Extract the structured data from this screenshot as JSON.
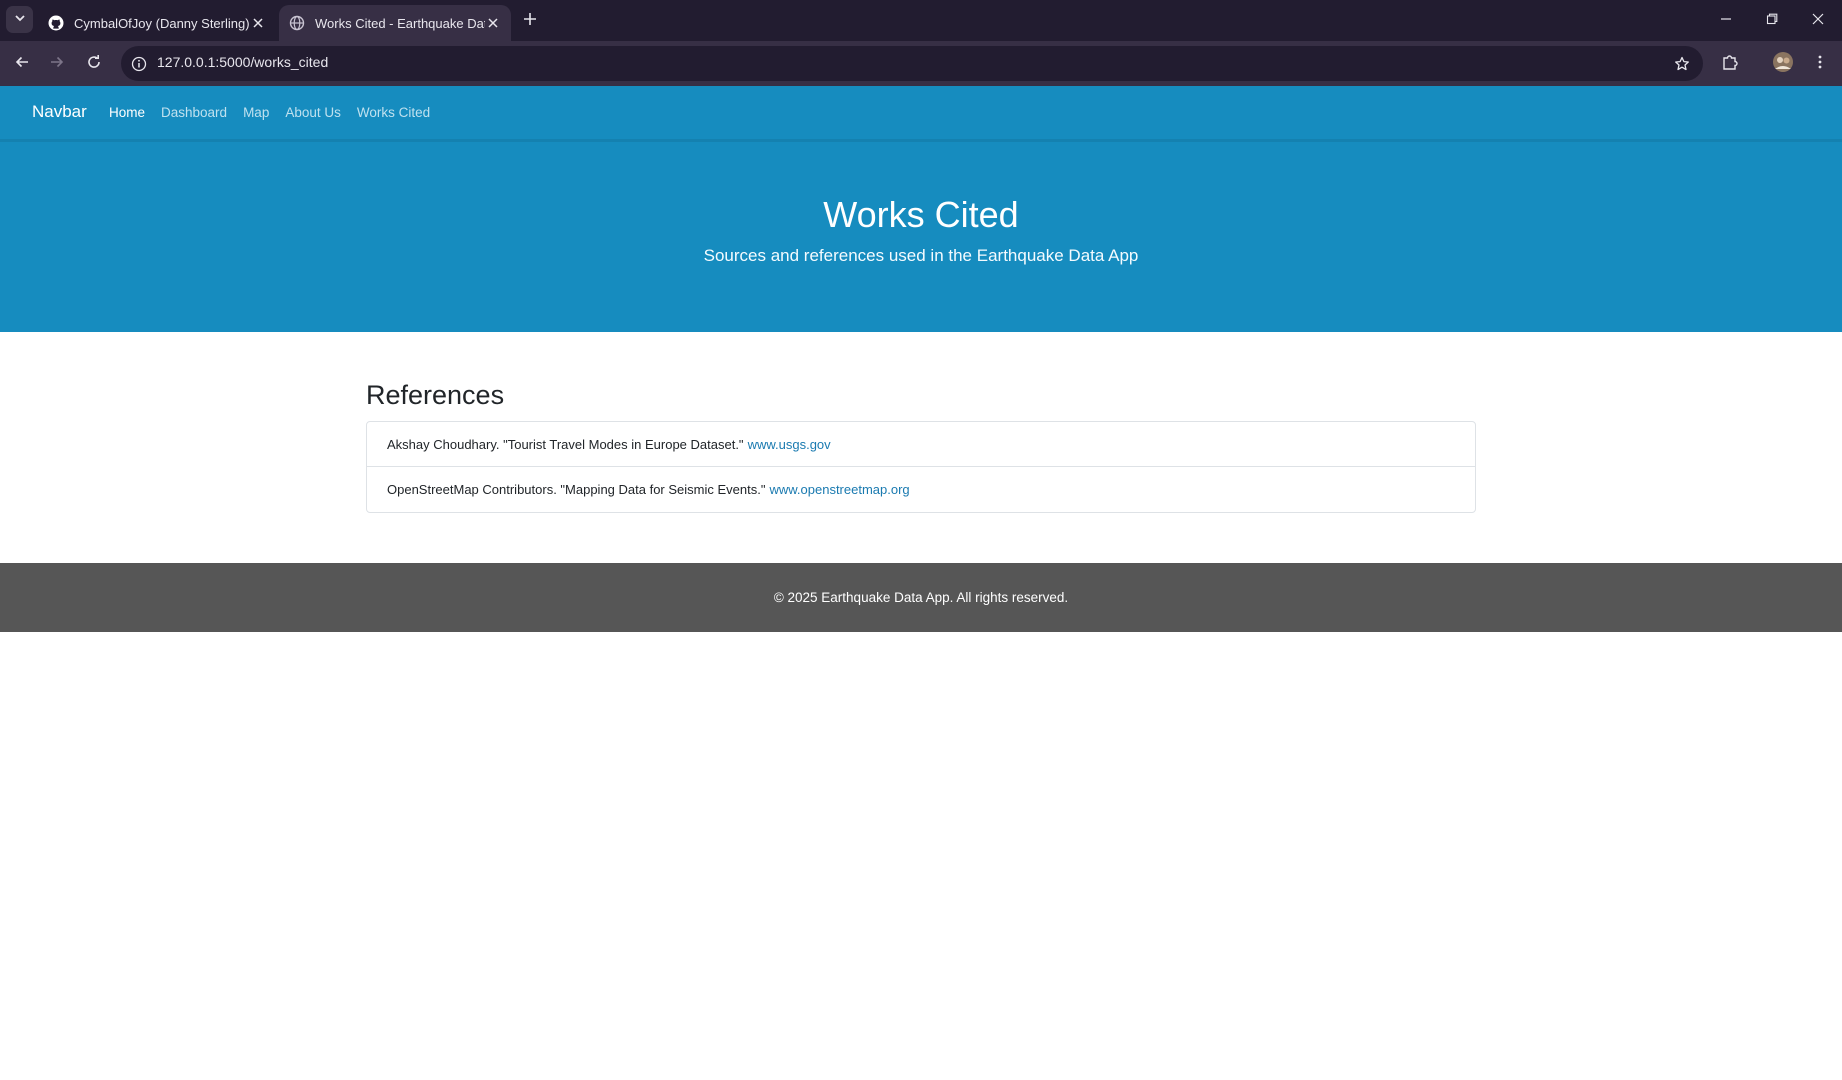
{
  "browser": {
    "tabs": [
      {
        "title": "CymbalOfJoy (Danny Sterling)",
        "icon": "github-icon"
      },
      {
        "title": "Works Cited - Earthquake Data",
        "icon": "globe-icon",
        "active": true
      }
    ],
    "url": "127.0.0.1:5000/works_cited"
  },
  "navbar": {
    "brand": "Navbar",
    "links": [
      "Home",
      "Dashboard",
      "Map",
      "About Us",
      "Works Cited"
    ],
    "active": "Home"
  },
  "hero": {
    "title": "Works Cited",
    "subtitle": "Sources and references used in the Earthquake Data App"
  },
  "references": {
    "heading": "References",
    "items": [
      {
        "text": "Akshay Choudhary. \"Tourist Travel Modes in Europe Dataset.\"",
        "link": "www.usgs.gov"
      },
      {
        "text": "OpenStreetMap Contributors. \"Mapping Data for Seismic Events.\"",
        "link": "www.openstreetmap.org"
      }
    ]
  },
  "footer": {
    "text": "© 2025 Earthquake Data App. All rights reserved."
  },
  "colors": {
    "brand_blue": "#168cbf",
    "footer_gray": "#565656",
    "link_blue": "#1a7ab0"
  }
}
